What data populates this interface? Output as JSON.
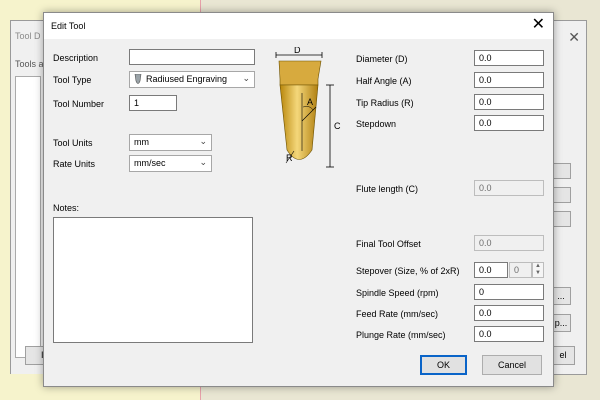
{
  "background": {
    "window_title": "Tool D",
    "tools_label": "Tools a",
    "btn_left": "Im",
    "btn_right_1": "...",
    "btn_right_2": "p...",
    "btn_right_3": "el"
  },
  "dialog": {
    "title": "Edit Tool",
    "close_icon": "✕"
  },
  "left": {
    "description_label": "Description",
    "description_value": "",
    "tool_type_label": "Tool Type",
    "tool_type_icon": "engraving-bit-icon",
    "tool_type_value": "Radiused Engraving",
    "tool_number_label": "Tool Number",
    "tool_number_value": "1",
    "tool_units_label": "Tool Units",
    "tool_units_value": "mm",
    "rate_units_label": "Rate Units",
    "rate_units_value": "mm/sec",
    "notes_label": "Notes:"
  },
  "diagram": {
    "d": "D",
    "a": "A",
    "c": "C",
    "r": "R"
  },
  "right": {
    "diameter_label": "Diameter (D)",
    "diameter_value": "0.0",
    "half_angle_label": "Half Angle (A)",
    "half_angle_value": "0.0",
    "tip_radius_label": "Tip Radius (R)",
    "tip_radius_value": "0.0",
    "stepdown_label": "Stepdown",
    "stepdown_value": "0.0",
    "flute_length_label": "Flute length (C)",
    "flute_length_value": "0.0",
    "final_offset_label": "Final Tool Offset",
    "final_offset_value": "0.0",
    "stepover_label": "Stepover (Size, % of 2xR)",
    "stepover_value": "0.0",
    "stepover_percent": "0",
    "spindle_label": "Spindle Speed (rpm)",
    "spindle_value": "0",
    "feed_label": "Feed Rate (mm/sec)",
    "feed_value": "0.0",
    "plunge_label": "Plunge Rate (mm/sec)",
    "plunge_value": "0.0"
  },
  "buttons": {
    "ok": "OK",
    "cancel": "Cancel"
  }
}
